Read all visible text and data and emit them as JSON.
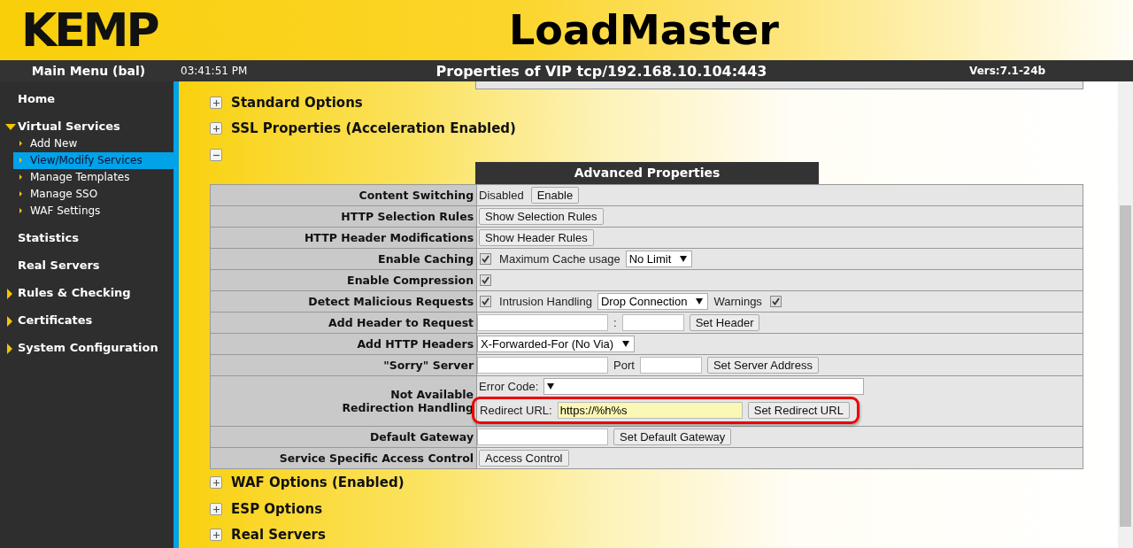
{
  "header": {
    "logo": "KEMP",
    "title": "LoadMaster"
  },
  "top_bar": {
    "menu_title": "Main Menu (bal)",
    "time": "03:41:51 PM",
    "page_title": "Properties of VIP tcp/192.168.10.104:443",
    "version": "Vers:7.1-24b"
  },
  "sidebar": {
    "items": [
      {
        "label": "Home",
        "kind": "link"
      },
      {
        "label": "Virtual Services",
        "kind": "group",
        "expanded": true,
        "children": [
          {
            "label": "Add New",
            "selected": false
          },
          {
            "label": "View/Modify Services",
            "selected": true
          },
          {
            "label": "Manage Templates",
            "selected": false
          },
          {
            "label": "Manage SSO",
            "selected": false
          },
          {
            "label": "WAF Settings",
            "selected": false
          }
        ]
      },
      {
        "label": "Statistics",
        "kind": "link"
      },
      {
        "label": "Real Servers",
        "kind": "link"
      },
      {
        "label": "Rules & Checking",
        "kind": "group",
        "expanded": false
      },
      {
        "label": "Certificates",
        "kind": "group",
        "expanded": false
      },
      {
        "label": "System Configuration",
        "kind": "group",
        "expanded": false
      }
    ]
  },
  "sections": [
    {
      "title": "Standard Options",
      "expanded": false
    },
    {
      "title": "SSL Properties (Acceleration Enabled)",
      "expanded": false
    },
    {
      "expanded": true,
      "panel": {
        "title": "Advanced Properties",
        "rows": [
          {
            "label": "Content Switching",
            "lines": [
              [
                {
                  "kind": "text",
                  "text": "Disabled"
                },
                {
                  "kind": "button",
                  "text": "Enable"
                }
              ]
            ]
          },
          {
            "label": "HTTP Selection Rules",
            "lines": [
              [
                {
                  "kind": "button",
                  "text": "Show Selection Rules"
                }
              ]
            ]
          },
          {
            "label": "HTTP Header Modifications",
            "lines": [
              [
                {
                  "kind": "button",
                  "text": "Show Header Rules"
                }
              ]
            ]
          },
          {
            "label": "Enable Caching",
            "lines": [
              [
                {
                  "kind": "checkbox",
                  "checked": true
                },
                {
                  "kind": "text",
                  "text": "Maximum Cache usage"
                },
                {
                  "kind": "select",
                  "value": "No Limit"
                }
              ]
            ]
          },
          {
            "label": "Enable Compression",
            "lines": [
              [
                {
                  "kind": "checkbox",
                  "checked": true
                }
              ]
            ]
          },
          {
            "label": "Detect Malicious Requests",
            "lines": [
              [
                {
                  "kind": "checkbox",
                  "checked": true
                },
                {
                  "kind": "text",
                  "text": "Intrusion Handling"
                },
                {
                  "kind": "select",
                  "value": "Drop Connection"
                },
                {
                  "kind": "text",
                  "text": "Warnings"
                },
                {
                  "kind": "checkbox",
                  "checked": true
                }
              ]
            ]
          },
          {
            "label": "Add Header to Request",
            "lines": [
              [
                {
                  "kind": "input"
                },
                {
                  "kind": "text",
                  "text": ":"
                },
                {
                  "kind": "input"
                },
                {
                  "kind": "button",
                  "text": "Set Header"
                }
              ]
            ]
          },
          {
            "label": "Add HTTP Headers",
            "lines": [
              [
                {
                  "kind": "select",
                  "value": "X-Forwarded-For (No Via)"
                }
              ]
            ]
          },
          {
            "label": "\"Sorry\" Server",
            "lines": [
              [
                {
                  "kind": "input"
                },
                {
                  "kind": "text",
                  "text": "Port"
                },
                {
                  "kind": "input"
                },
                {
                  "kind": "button",
                  "text": "Set Server Address"
                }
              ]
            ]
          },
          {
            "label": "Not Available\nRedirection Handling",
            "lines": [
              [
                {
                  "kind": "text",
                  "text": "Error Code:"
                },
                {
                  "kind": "select"
                }
              ],
              [
                {
                  "kind": "highlight",
                  "on": true
                },
                {
                  "kind": "text",
                  "text": "Redirect URL:"
                },
                {
                  "kind": "input",
                  "value": "https://%h%s"
                },
                {
                  "kind": "button",
                  "text": "Set Redirect URL"
                }
              ]
            ]
          },
          {
            "label": "Default Gateway",
            "lines": [
              [
                {
                  "kind": "input"
                },
                {
                  "kind": "button",
                  "text": "Set Default Gateway"
                }
              ]
            ]
          },
          {
            "label": "Service Specific Access Control",
            "lines": [
              [
                {
                  "kind": "button",
                  "text": "Access Control"
                }
              ]
            ]
          }
        ]
      }
    },
    {
      "title": "WAF Options (Enabled)",
      "expanded": false
    },
    {
      "title": "ESP Options",
      "expanded": false
    },
    {
      "title": "Real Servers",
      "expanded": false
    }
  ]
}
